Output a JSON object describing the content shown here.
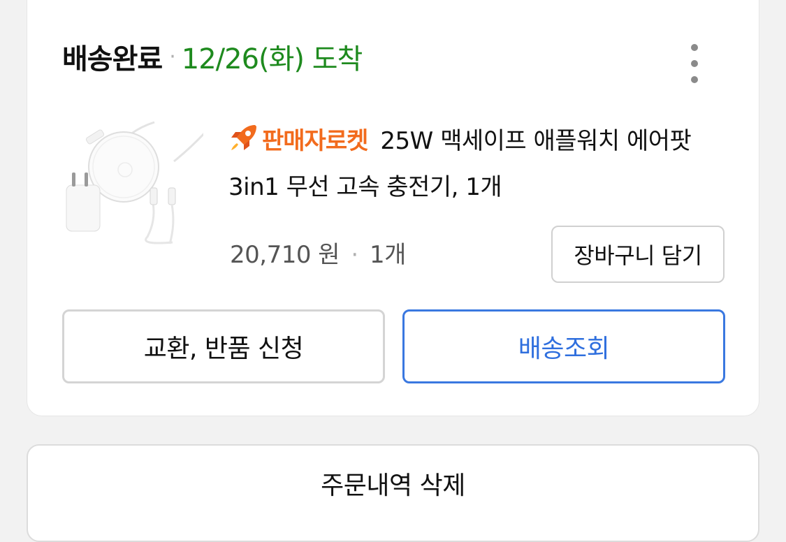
{
  "order": {
    "status": "배송완료",
    "separator": "·",
    "arrival": "12/26(화) 도착",
    "menu_icon": "more-vertical-icon"
  },
  "product": {
    "thumbnail_icon": "wireless-charger-product-image",
    "badge_icon": "rocket-icon",
    "seller_badge": "판매자로켓",
    "name": "25W 맥세이프 애플워치 에어팟 3in1 무선 고속 충전기, 1개",
    "price": "20,710 원",
    "price_separator": "·",
    "quantity": "1개",
    "add_to_cart_label": "장바구니 담기"
  },
  "actions": {
    "exchange_return_label": "교환, 반품 신청",
    "track_delivery_label": "배송조회"
  },
  "footer": {
    "delete_order_label": "주문내역 삭제"
  },
  "colors": {
    "arrival_green": "#1e8a1e",
    "rocket_orange": "#f26b1d",
    "track_blue": "#2f6fde",
    "background": "#f2f2f2"
  }
}
